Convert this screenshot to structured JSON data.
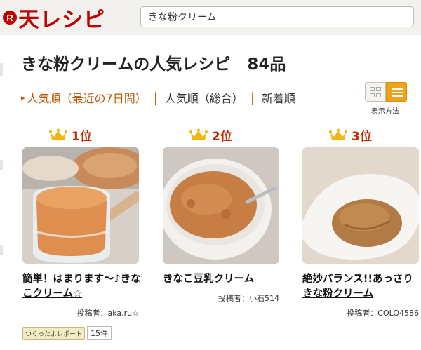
{
  "header": {
    "logo_mark": "R",
    "logo_text": "天レシピ",
    "search_value": "きな粉クリーム"
  },
  "page": {
    "title": "きな粉クリームの人気レシピ",
    "count": "84品"
  },
  "sort_tabs": [
    {
      "label": "人気順（最近の7日間）",
      "active": true
    },
    {
      "label": "人気順（総合）",
      "active": false
    },
    {
      "label": "新着順",
      "active": false
    }
  ],
  "view_toggle": {
    "label": "表示方法",
    "options": [
      "grid",
      "list"
    ],
    "selected": "list"
  },
  "colors": {
    "brand": "#bf0000",
    "accent": "#bf5600",
    "crown": "#f2b50d",
    "toggle_active": "#f0a31a"
  },
  "recipes": [
    {
      "rank": "1位",
      "title": "簡単！はまります〜♪きなこクリーム☆",
      "author": "投稿者：aka.ru☆",
      "icon": "crown-icon"
    },
    {
      "rank": "2位",
      "title": "きなこ豆乳クリーム",
      "author": "投稿者：小石514",
      "icon": "crown-icon"
    },
    {
      "rank": "3位",
      "title": "絶妙バランス!!あっさりきな粉クリーム",
      "author": "投稿者：COLO4586",
      "icon": "crown-icon"
    }
  ],
  "report": {
    "badge": "つくったよレポート",
    "count": "15件"
  }
}
